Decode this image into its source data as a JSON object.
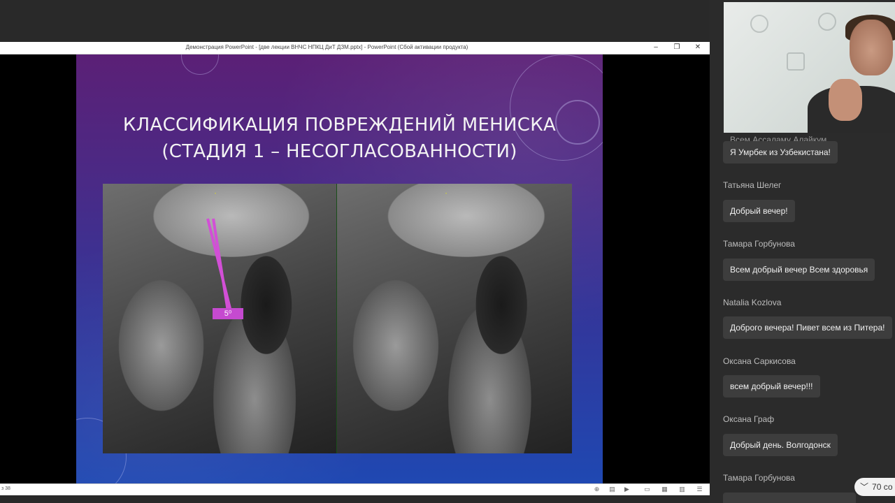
{
  "window": {
    "title": "Демонстрация PowerPoint - [две лекции ВНЧС НПКЦ ДиТ ДЗМ.pptx] - PowerPoint (Сбой активации продукта)",
    "controls": {
      "minimize": "–",
      "restore": "❐",
      "close": "✕"
    }
  },
  "slide": {
    "title_line1": "КЛАССИФИКАЦИЯ ПОВРЕЖДЕНИЙ МЕНИСКА",
    "title_line2": "(СТАДИЯ 1 – НЕСОГЛАСОВАННОСТИ)",
    "angle_label": "5⁰"
  },
  "statusbar": {
    "slide_counter": "з 38"
  },
  "chat": {
    "partial_top": "Всем Ассаламу Алайкум",
    "messages": [
      {
        "author": "",
        "text": "Я Умрбек из Узбекистана!"
      },
      {
        "author": "Татьяна Шелег",
        "text": "Добрый вечер!"
      },
      {
        "author": "Тамара Горбунова",
        "text": "Всем добрый вечер Всем здоровья"
      },
      {
        "author": "Natalia Kozlova",
        "text": "Доброго вечера! Пивет всем из Питера!"
      },
      {
        "author": "Оксана Саркисова",
        "text": "всем добрый вечер!!!"
      },
      {
        "author": "Оксана Граф",
        "text": "Добрый день. Волгодонск"
      },
      {
        "author": "Тамара Горбунова",
        "text": ""
      }
    ],
    "new_messages_label": "70 со"
  }
}
